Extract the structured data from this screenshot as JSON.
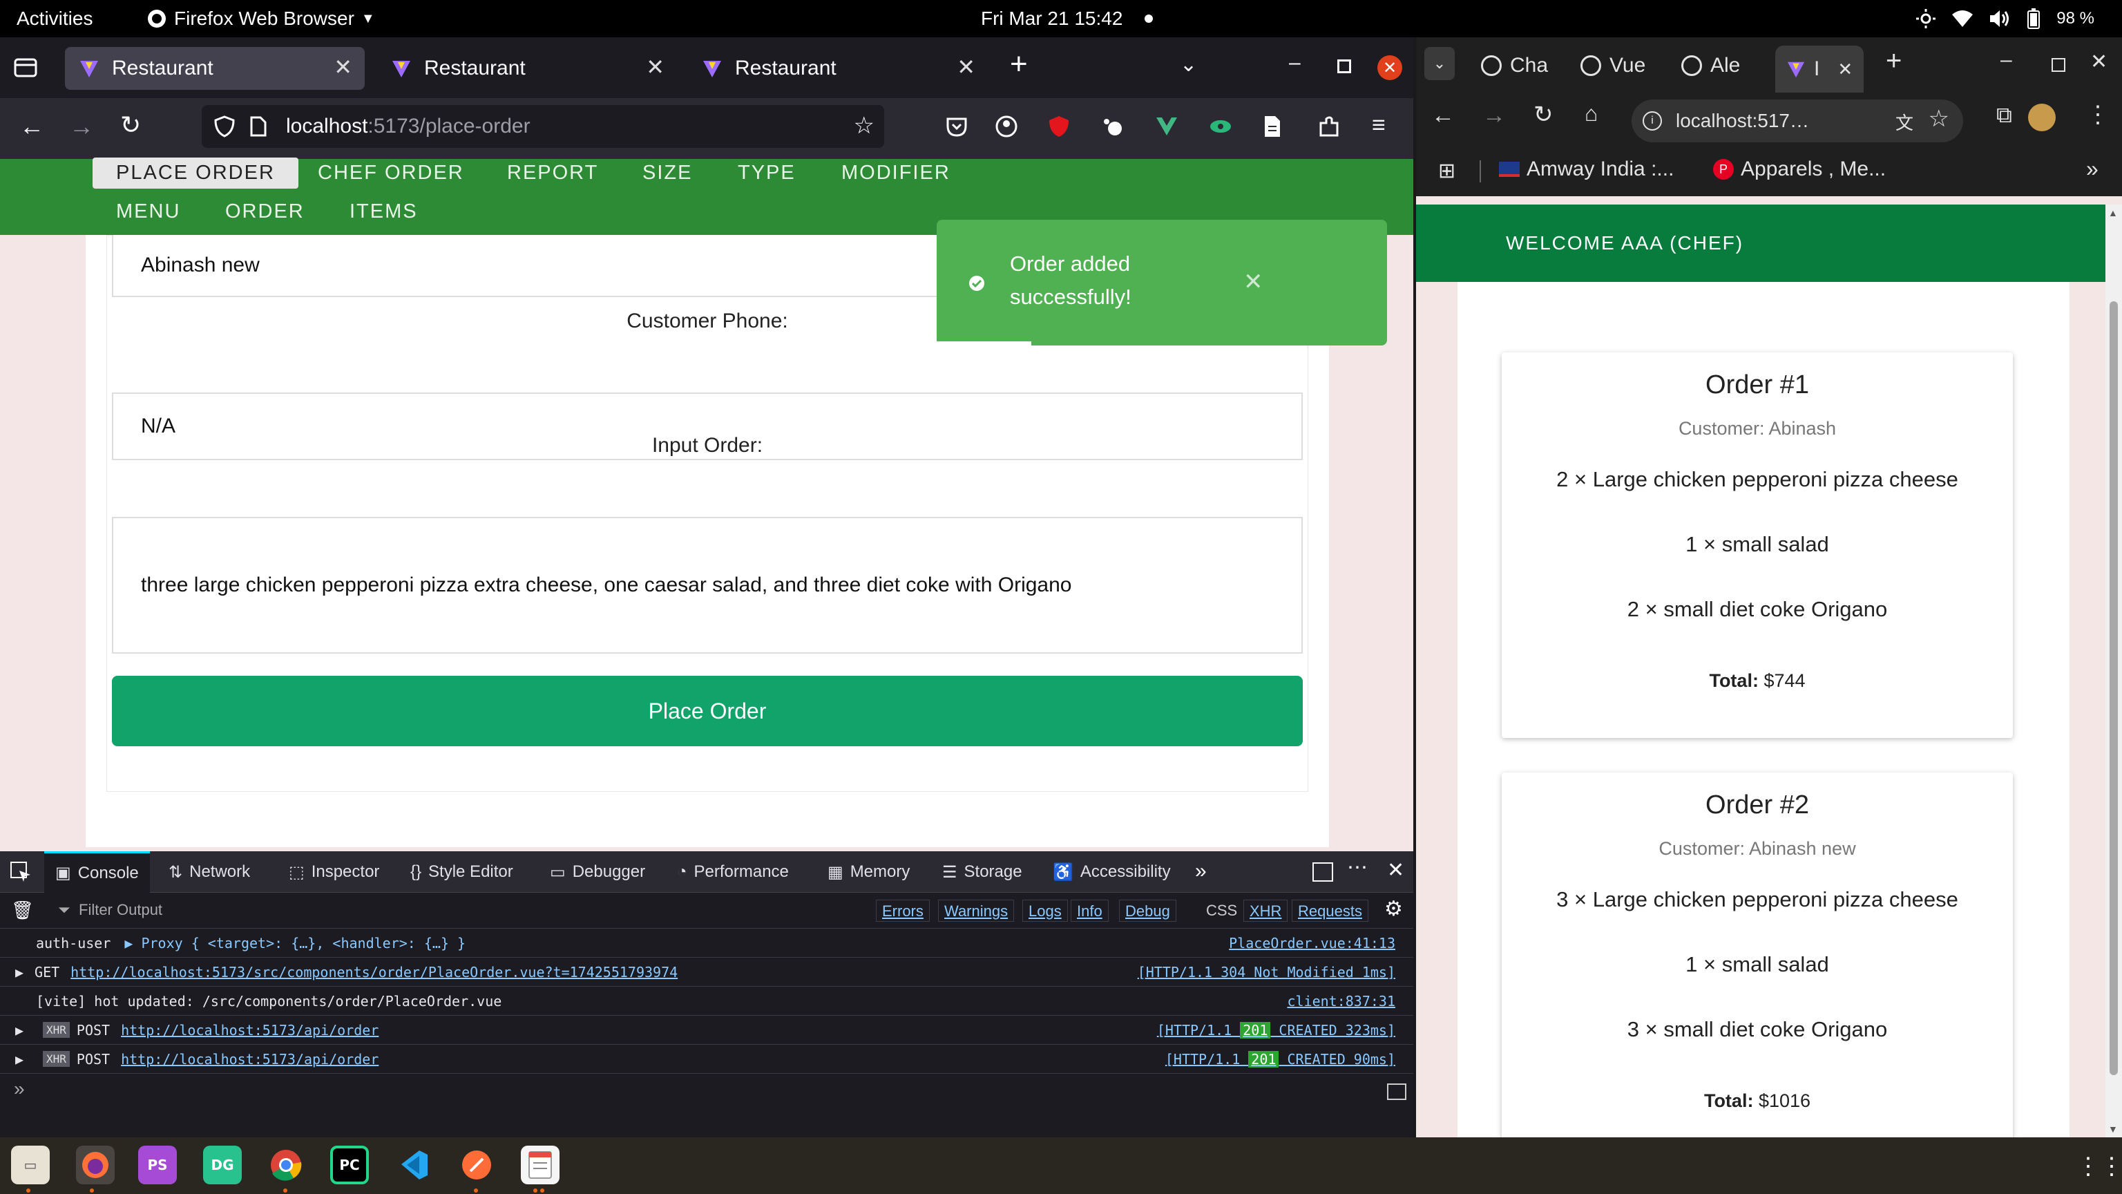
{
  "topbar": {
    "activities": "Activities",
    "app_name": "Firefox Web Browser",
    "datetime": "Fri Mar 21  15:42",
    "battery": "98 %"
  },
  "firefox": {
    "tabs": [
      {
        "label": "Restaurant",
        "active": true
      },
      {
        "label": "Restaurant",
        "active": false
      },
      {
        "label": "Restaurant",
        "active": false
      }
    ],
    "url_host": "localhost",
    "url_rest": ":5173/place-order",
    "nav_row1": [
      "PLACE ORDER",
      "CHEF ORDER",
      "REPORT",
      "SIZE",
      "TYPE",
      "MODIFIER"
    ],
    "nav_row2": [
      "MENU",
      "ORDER",
      "ITEMS"
    ],
    "form": {
      "customer_name_value": "Abinash new",
      "phone_label": "Customer Phone:",
      "phone_value": "N/A",
      "order_label": "Input Order:",
      "order_value": "three large chicken pepperoni pizza extra cheese, one caesar salad, and three diet coke with Origano",
      "submit_label": "Place Order"
    },
    "toast": {
      "message_line1": "Order added",
      "message_line2": "successfully!",
      "progress_fraction": 0.21
    }
  },
  "devtools": {
    "tabs": [
      "Console",
      "Network",
      "Inspector",
      "Style Editor",
      "Debugger",
      "Performance",
      "Memory",
      "Storage",
      "Accessibility"
    ],
    "filter_placeholder": "Filter Output",
    "filters": [
      "Errors",
      "Warnings",
      "Logs",
      "Info",
      "Debug"
    ],
    "filters2": [
      "CSS",
      "XHR",
      "Requests"
    ],
    "logs": [
      {
        "text": "auth-user",
        "obj": "Proxy { <target>: {…}, <handler>: {…} }",
        "src": "PlaceOrder.vue:41:13"
      },
      {
        "method": "GET",
        "url": "http://localhost:5173/src/components/order/PlaceOrder.vue?t=1742551793974",
        "src": "[HTTP/1.1  304  Not Modified 1ms]"
      },
      {
        "text": "[vite] hot updated: /src/components/order/PlaceOrder.vue",
        "src": "client:837:31"
      },
      {
        "badge": "XHR",
        "method": "POST",
        "url": "http://localhost:5173/api/order",
        "src_pre": "[HTTP/1.1 ",
        "status": "201",
        "src_post": " CREATED 323ms]"
      },
      {
        "badge": "XHR",
        "method": "POST",
        "url": "http://localhost:5173/api/order",
        "src_pre": "[HTTP/1.1 ",
        "status": "201",
        "src_post": " CREATED 90ms]"
      }
    ]
  },
  "chrome": {
    "tabs": [
      "Cha",
      "Vue",
      "Ale",
      "I"
    ],
    "url": "localhost:517…",
    "bookmarks": [
      "Amway India :...",
      "Apparels , Me..."
    ],
    "welcome": "WELCOME AAA (CHEF)",
    "orders": [
      {
        "title": "Order #1",
        "customer": "Customer: Abinash",
        "items": [
          "2 × Large chicken pepperoni pizza cheese",
          "1 × small salad",
          "2 × small diet coke Origano"
        ],
        "total_label": "Total:",
        "total_value": "$744"
      },
      {
        "title": "Order #2",
        "customer": "Customer: Abinash new",
        "items": [
          "3 × Large chicken pepperoni pizza cheese",
          "1 × small salad",
          "3 × small diet coke Origano"
        ],
        "total_label": "Total:",
        "total_value": "$1016"
      }
    ]
  },
  "taskbar": {
    "apps": [
      "files-icon",
      "firefox-icon",
      "phpstorm-icon",
      "datagrip-icon",
      "chrome-icon",
      "pycharm-icon",
      "vscode-icon",
      "postman-icon",
      "text-editor-icon"
    ]
  }
}
